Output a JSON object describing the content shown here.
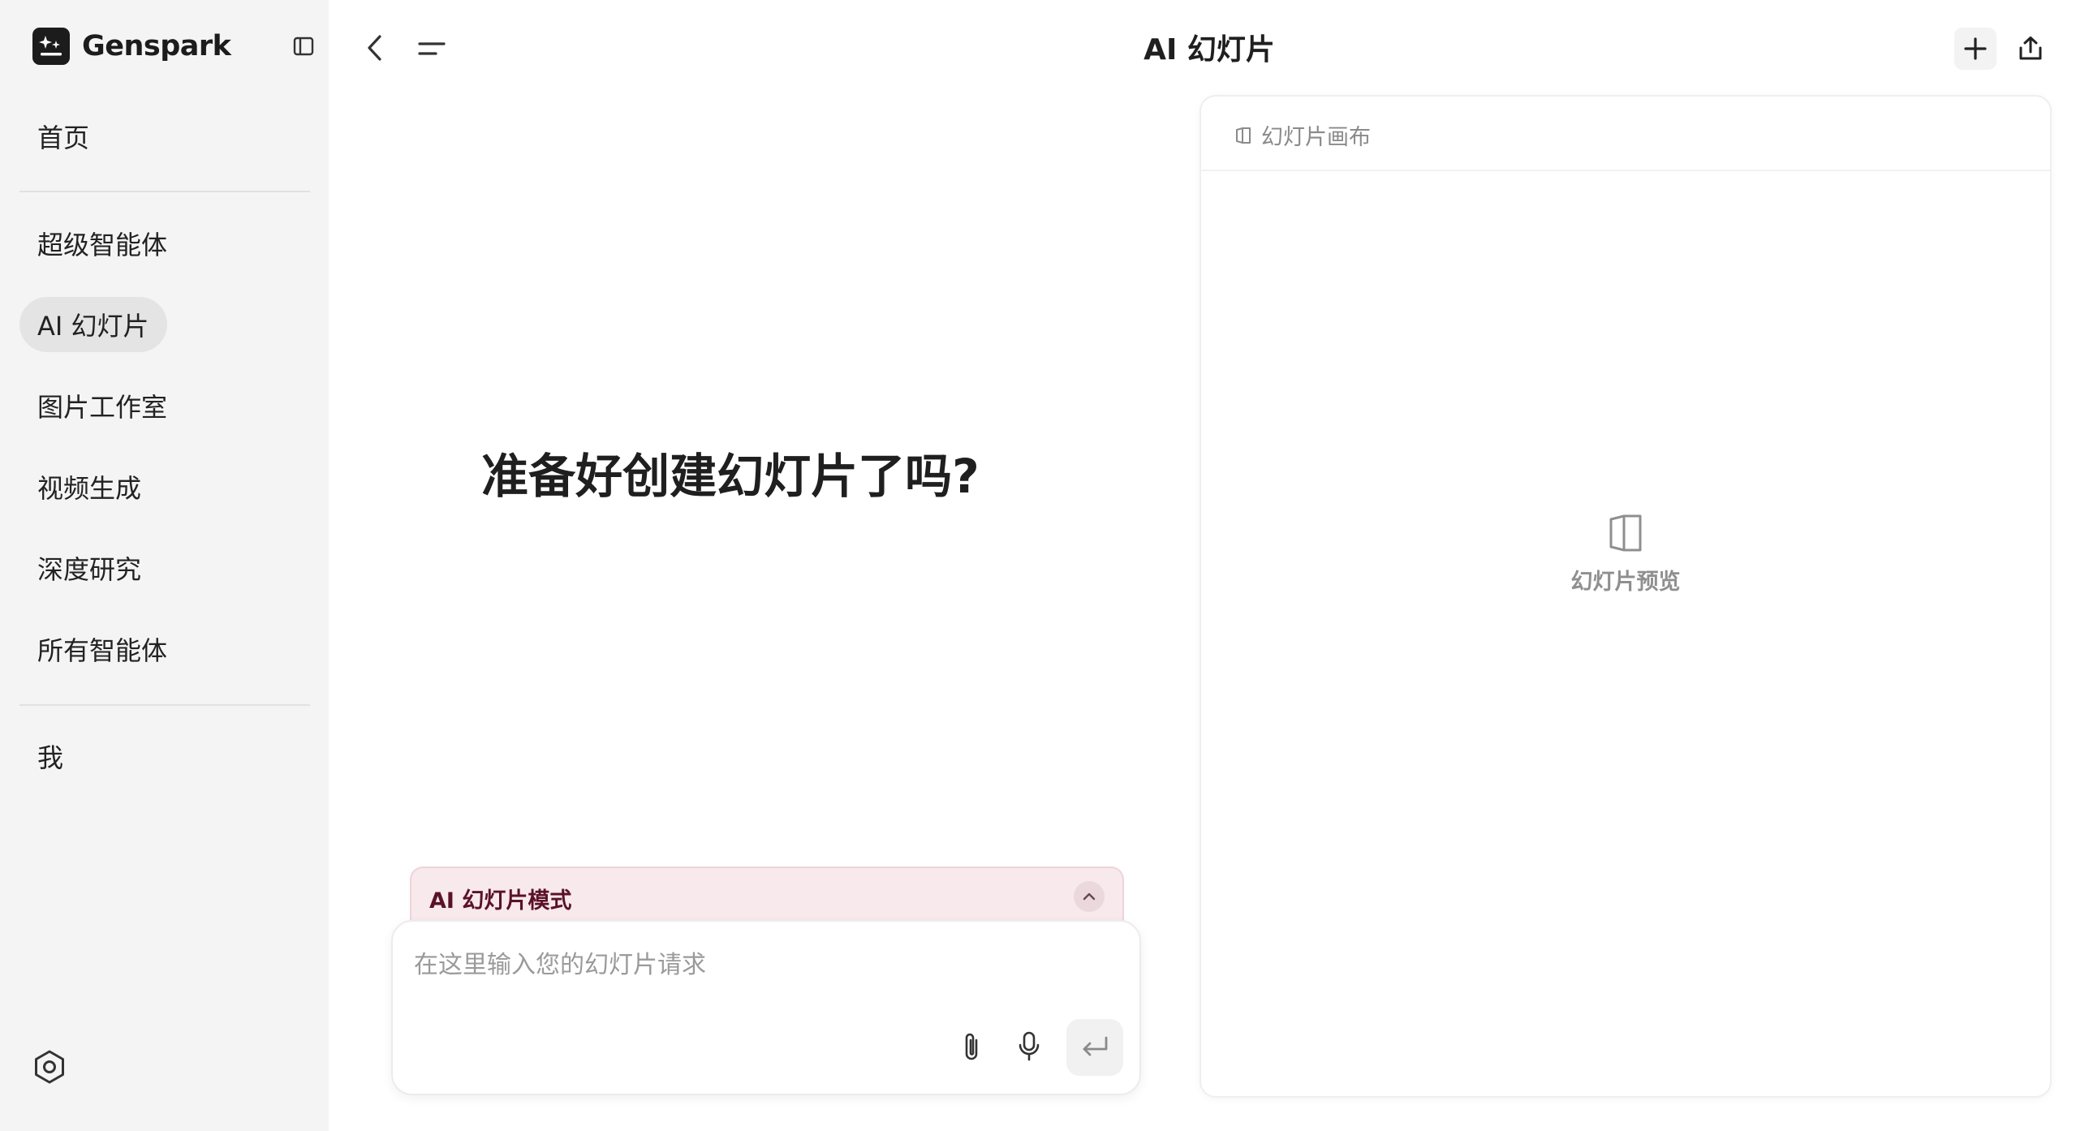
{
  "sidebar": {
    "brand": "Genspark",
    "items": [
      {
        "label": "首页"
      },
      {
        "label": "超级智能体"
      },
      {
        "label": "AI 幻灯片",
        "active": true
      },
      {
        "label": "图片工作室"
      },
      {
        "label": "视频生成"
      },
      {
        "label": "深度研究"
      },
      {
        "label": "所有智能体"
      },
      {
        "label": "我"
      }
    ],
    "icons": {
      "collapse": "sidebar-toggle-icon",
      "settings": "settings-icon"
    }
  },
  "header": {
    "title": "AI 幻灯片",
    "icons": [
      "back-icon",
      "menu-icon",
      "plus-icon",
      "share-icon"
    ]
  },
  "main": {
    "headline": "准备好创建幻灯片了吗?",
    "mode": {
      "label": "AI 幻灯片模式",
      "expanded": true
    },
    "composer": {
      "placeholder": "在这里输入您的幻灯片请求",
      "value": "",
      "icons": [
        "paperclip-icon",
        "microphone-icon",
        "enter-icon"
      ]
    }
  },
  "canvas": {
    "tab_label": "幻灯片画布",
    "empty_label": "幻灯片预览"
  },
  "colors": {
    "sidebar_bg": "#f4f4f4",
    "active_item_bg": "#e4e4e4",
    "mode_banner_bg": "#f7e9ec",
    "mode_text": "#5a1228"
  }
}
